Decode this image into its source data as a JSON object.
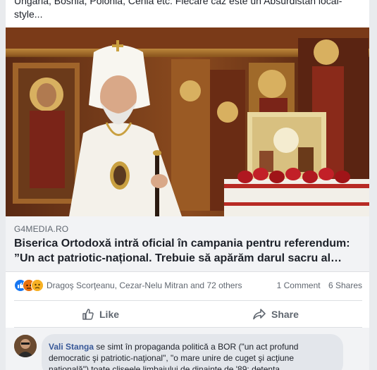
{
  "post": {
    "text_lines": [
      "Ungaria, Bosnia, Polonia, Cehia etc. Fiecare caz este un Absurdistan local-",
      "style..."
    ]
  },
  "link": {
    "domain": "G4MEDIA.RO",
    "headline_lines": [
      "Biserica Ortodoxă intră oficial în campania pentru referendum:",
      "”Un act patriotic-național. Trebuie să apărăm darul sacru al…"
    ]
  },
  "reactions": {
    "icons": [
      "like-reaction",
      "angry-reaction",
      "sad-reaction"
    ],
    "names": "Dragoş Scorţeanu, Cezar-Nelu Mitran and 72 others",
    "comments": "1 Comment",
    "shares": "6 Shares"
  },
  "actions": {
    "like_label": "Like",
    "share_label": "Share"
  },
  "comment": {
    "author": "Vali Stanga",
    "lines": [
      "se simt în propaganda politică a BOR (\"un act profund",
      "democratic şi patriotic-naţional\", \"o mare unire de cuget şi acţiune",
      "naţională\") toate clişeele limbajului de dinainte de '89: detenta"
    ]
  },
  "colors": {
    "link_blue": "#385898",
    "like_blue": "#1877f2",
    "angry_orange": "#e9710f",
    "sad_yellow": "#f7b125"
  }
}
